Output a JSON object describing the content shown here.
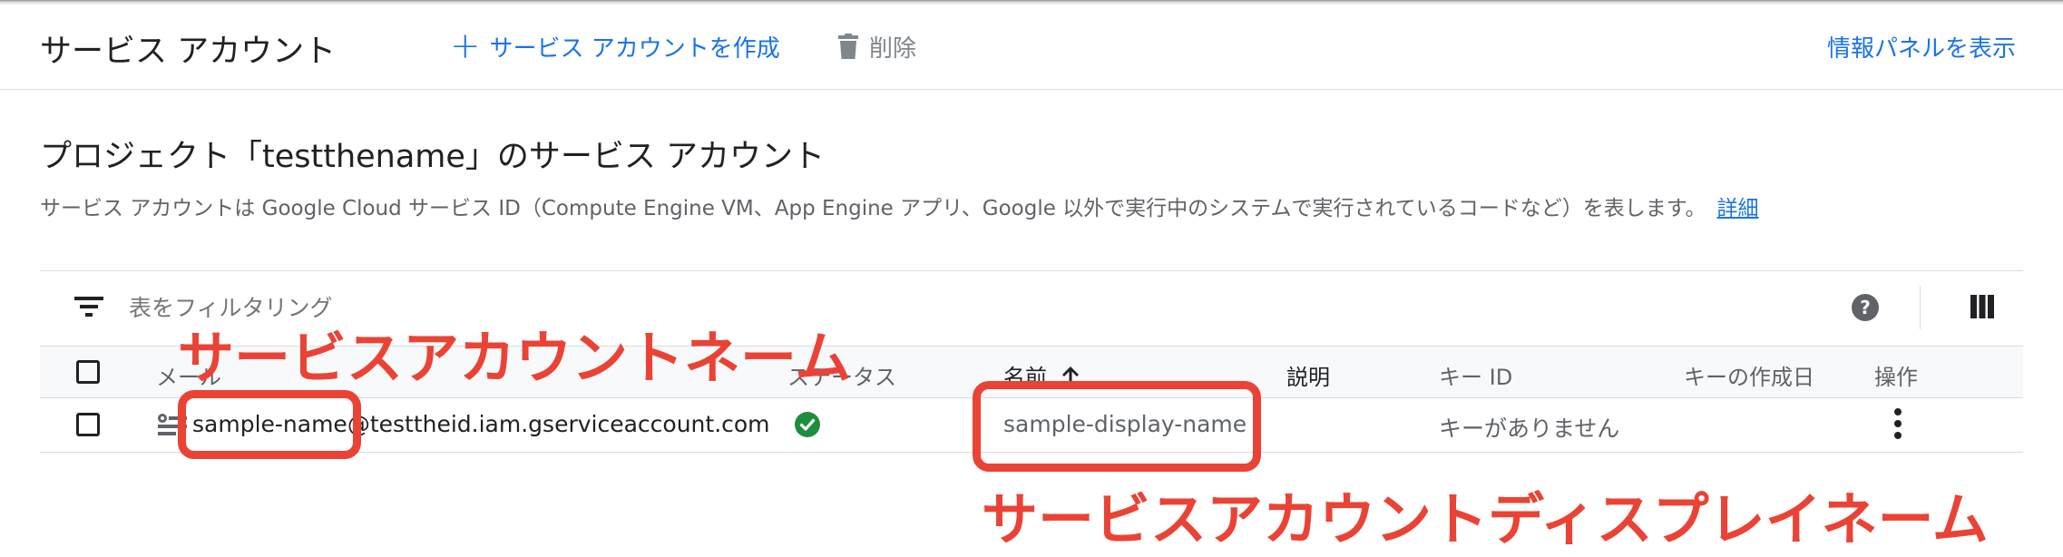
{
  "header": {
    "title": "サービス アカウント",
    "create_label": "サービス アカウントを作成",
    "delete_label": "削除",
    "info_panel_label": "情報パネルを表示"
  },
  "section": {
    "title": "プロジェクト「testthename」のサービス アカウント",
    "description": "サービス アカウントは Google Cloud サービス ID（Compute Engine VM、App Engine アプリ、Google 以外で実行中のシステムで実行されているコードなど）を表します。",
    "details_link": "詳細"
  },
  "filter": {
    "placeholder": "表をフィルタリング"
  },
  "table": {
    "columns": {
      "email": "メール",
      "status": "ステータス",
      "name": "名前",
      "description": "説明",
      "key_id": "キー ID",
      "key_created": "キーの作成日",
      "actions": "操作"
    },
    "sort_column": "名前",
    "sort_direction": "ascending",
    "rows": [
      {
        "email": "sample-name@testtheid.iam.gserviceaccount.com",
        "status": "enabled",
        "name": "sample-display-name",
        "description": "",
        "key_id": "キーがありません",
        "key_created": ""
      }
    ]
  },
  "annotations": {
    "account_name": "サービスアカウントネーム",
    "display_name": "サービスアカウントディスプレイネーム",
    "color": "#ea4335"
  },
  "colors": {
    "accent": "#1a73e8",
    "status_ok": "#1e8e3e",
    "annotation": "#ea4335"
  },
  "icons": {
    "create": "plus-icon",
    "delete": "trash-icon",
    "filter": "filter-list-icon",
    "help": "help-icon",
    "columns": "column-display-icon",
    "service_account": "service-account-icon",
    "status": "check-circle-icon",
    "more": "more-vert-icon",
    "sort": "arrow-upward-icon"
  }
}
